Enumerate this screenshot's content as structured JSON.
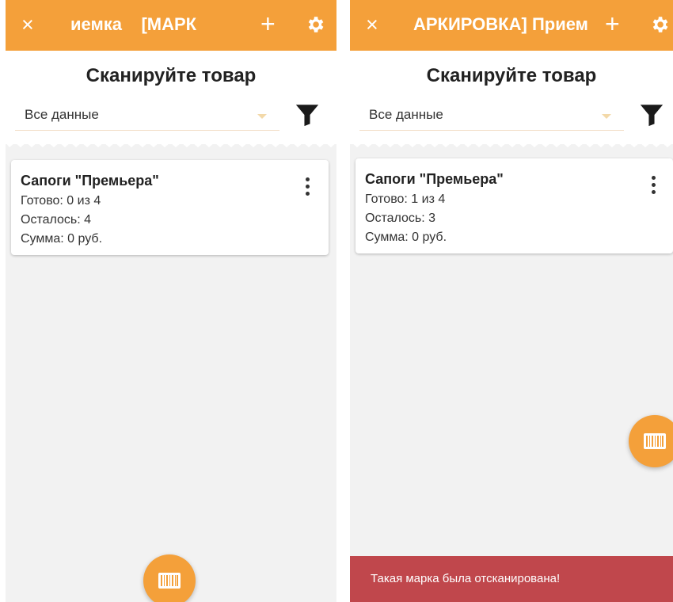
{
  "colors": {
    "accent": "#f4a03a",
    "toast_bg": "#c0474c",
    "screen_bg": "#f2f2f2"
  },
  "left": {
    "topbar": {
      "close_icon": "×",
      "title": "иемка    [МАРК",
      "plus_icon": "+",
      "settings_icon": "gear-icon"
    },
    "heading": "Сканируйте товар",
    "filter_select": {
      "value": "Все данные"
    },
    "card": {
      "name": "Сапоги \"Премьера\"",
      "ready": "Готово: 0 из 4",
      "remaining": "Осталось: 4",
      "sum": "Сумма: 0 руб."
    },
    "fab_icon": "barcode-icon"
  },
  "right": {
    "topbar": {
      "close_icon": "×",
      "title": "АРКИРОВКА] Прием",
      "plus_icon": "+",
      "settings_icon": "gear-icon"
    },
    "heading": "Сканируйте товар",
    "filter_select": {
      "value": "Все данные"
    },
    "card": {
      "name": "Сапоги \"Премьера\"",
      "ready": "Готово: 1 из 4",
      "remaining": "Осталось: 3",
      "sum": "Сумма: 0 руб."
    },
    "fab_icon": "barcode-icon",
    "toast": "Такая марка была отсканирована!"
  }
}
